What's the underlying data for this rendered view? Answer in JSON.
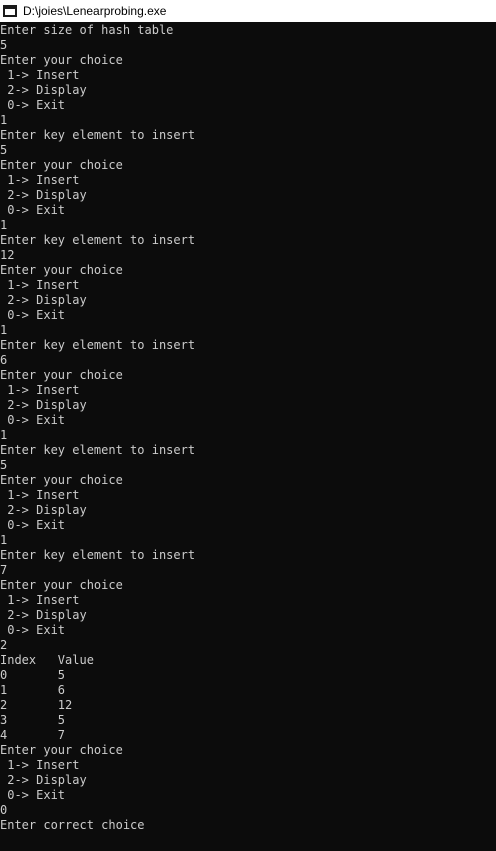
{
  "window": {
    "title": "D:\\joies\\Lenearprobing.exe",
    "icon": "console-window-icon"
  },
  "console": {
    "lines": [
      "Enter size of hash table",
      "5",
      "Enter your choice",
      " 1-> Insert",
      " 2-> Display",
      " 0-> Exit",
      "1",
      "Enter key element to insert",
      "5",
      "Enter your choice",
      " 1-> Insert",
      " 2-> Display",
      " 0-> Exit",
      "1",
      "Enter key element to insert",
      "12",
      "Enter your choice",
      " 1-> Insert",
      " 2-> Display",
      " 0-> Exit",
      "1",
      "Enter key element to insert",
      "6",
      "Enter your choice",
      " 1-> Insert",
      " 2-> Display",
      " 0-> Exit",
      "1",
      "Enter key element to insert",
      "5",
      "Enter your choice",
      " 1-> Insert",
      " 2-> Display",
      " 0-> Exit",
      "1",
      "Enter key element to insert",
      "7",
      "Enter your choice",
      " 1-> Insert",
      " 2-> Display",
      " 0-> Exit",
      "2",
      "Index   Value",
      "0       5",
      "1       6",
      "2       12",
      "3       5",
      "4       7",
      "Enter your choice",
      " 1-> Insert",
      " 2-> Display",
      " 0-> Exit",
      "0",
      "Enter correct choice"
    ]
  },
  "colors": {
    "background": "#0c0c0c",
    "text": "#cccccc",
    "titlebar": "#ffffff"
  }
}
